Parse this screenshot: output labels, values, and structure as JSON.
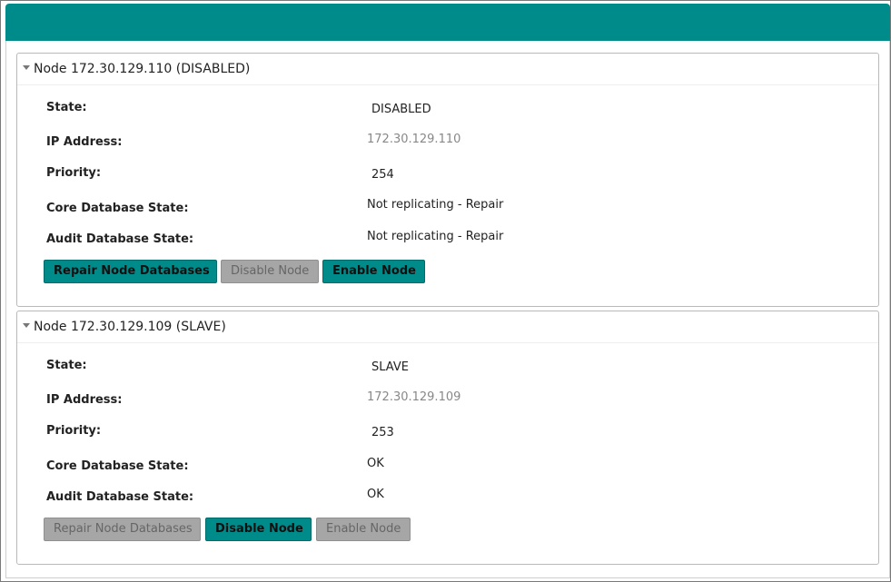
{
  "nodes": [
    {
      "title": "Node 172.30.129.110 (DISABLED)",
      "fields": [
        {
          "label": "State:",
          "value": "DISABLED"
        },
        {
          "label": "IP Address:",
          "value": "172.30.129.110"
        },
        {
          "label": "Priority:",
          "value": "254"
        },
        {
          "label": "Core Database State:",
          "value": "Not replicating - Repair"
        },
        {
          "label": "Audit Database State:",
          "value": "Not replicating - Repair"
        }
      ],
      "buttons": {
        "repair": {
          "label": "Repair Node Databases",
          "enabled": true
        },
        "disable": {
          "label": "Disable Node",
          "enabled": false
        },
        "enable": {
          "label": "Enable Node",
          "enabled": true
        }
      }
    },
    {
      "title": "Node 172.30.129.109 (SLAVE)",
      "fields": [
        {
          "label": "State:",
          "value": "SLAVE"
        },
        {
          "label": "IP Address:",
          "value": "172.30.129.109"
        },
        {
          "label": "Priority:",
          "value": "253"
        },
        {
          "label": "Core Database State:",
          "value": "OK"
        },
        {
          "label": "Audit Database State:",
          "value": "OK"
        }
      ],
      "buttons": {
        "repair": {
          "label": "Repair Node Databases",
          "enabled": false
        },
        "disable": {
          "label": "Disable Node",
          "enabled": true
        },
        "enable": {
          "label": "Enable Node",
          "enabled": false
        }
      }
    }
  ],
  "colors": {
    "accent": "#008b8b",
    "disabled_button": "#a6a6a6",
    "panel_border": "#b9b9b9"
  },
  "icons": {
    "panel_toggle": "caret-down-icon"
  }
}
